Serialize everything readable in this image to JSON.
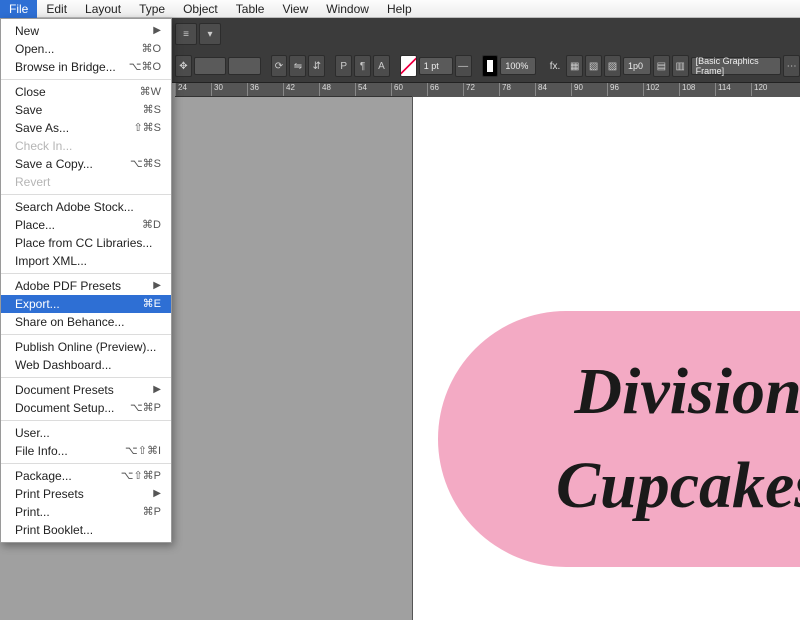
{
  "menubar": [
    "File",
    "Edit",
    "Layout",
    "Type",
    "Object",
    "Table",
    "View",
    "Window",
    "Help"
  ],
  "menubar_active_index": 0,
  "dropdown": {
    "groups": [
      [
        {
          "label": "New",
          "shortcut": "",
          "arrow": true
        },
        {
          "label": "Open...",
          "shortcut": "⌘O"
        },
        {
          "label": "Browse in Bridge...",
          "shortcut": "⌥⌘O"
        }
      ],
      [
        {
          "label": "Close",
          "shortcut": "⌘W"
        },
        {
          "label": "Save",
          "shortcut": "⌘S"
        },
        {
          "label": "Save As...",
          "shortcut": "⇧⌘S"
        },
        {
          "label": "Check In...",
          "shortcut": "",
          "disabled": true
        },
        {
          "label": "Save a Copy...",
          "shortcut": "⌥⌘S"
        },
        {
          "label": "Revert",
          "shortcut": "",
          "disabled": true
        }
      ],
      [
        {
          "label": "Search Adobe Stock...",
          "shortcut": ""
        },
        {
          "label": "Place...",
          "shortcut": "⌘D"
        },
        {
          "label": "Place from CC Libraries...",
          "shortcut": ""
        },
        {
          "label": "Import XML...",
          "shortcut": ""
        }
      ],
      [
        {
          "label": "Adobe PDF Presets",
          "shortcut": "",
          "arrow": true
        },
        {
          "label": "Export...",
          "shortcut": "⌘E",
          "selected": true
        },
        {
          "label": "Share on Behance...",
          "shortcut": ""
        }
      ],
      [
        {
          "label": "Publish Online (Preview)...",
          "shortcut": ""
        },
        {
          "label": "Web Dashboard...",
          "shortcut": ""
        }
      ],
      [
        {
          "label": "Document Presets",
          "shortcut": "",
          "arrow": true
        },
        {
          "label": "Document Setup...",
          "shortcut": "⌥⌘P"
        }
      ],
      [
        {
          "label": "User...",
          "shortcut": ""
        },
        {
          "label": "File Info...",
          "shortcut": "⌥⇧⌘I"
        }
      ],
      [
        {
          "label": "Package...",
          "shortcut": "⌥⇧⌘P"
        },
        {
          "label": "Print Presets",
          "shortcut": "",
          "arrow": true
        },
        {
          "label": "Print...",
          "shortcut": "⌘P"
        },
        {
          "label": "Print Booklet...",
          "shortcut": ""
        }
      ]
    ]
  },
  "toolbar": {
    "stroke_pt": "1 pt",
    "zoom": "100%",
    "pagefield": "1p0",
    "frame_label": "[Basic Graphics Frame]"
  },
  "ruler_ticks": [
    "24",
    "30",
    "36",
    "42",
    "48",
    "54",
    "60",
    "66",
    "72",
    "78",
    "84",
    "90",
    "96",
    "102",
    "108",
    "114",
    "120"
  ],
  "canvas": {
    "line1": "Division",
    "line2": "Cupcakes"
  }
}
